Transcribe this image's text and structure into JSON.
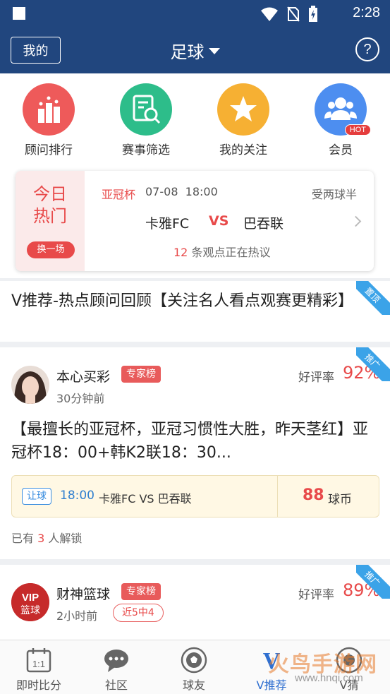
{
  "status_bar": {
    "time": "2:28"
  },
  "header": {
    "my_label": "我的",
    "title": "足球",
    "help_label": "?"
  },
  "quick_actions": [
    {
      "label": "顾问排行",
      "color": "#ee5a5a"
    },
    {
      "label": "赛事筛选",
      "color": "#2dbd8a"
    },
    {
      "label": "我的关注",
      "color": "#f6b033"
    },
    {
      "label": "会员",
      "color": "#4d8ef0",
      "badge": "HOT"
    }
  ],
  "hot_today": {
    "title": "今日热门",
    "swap_label": "换一场",
    "league": "亚冠杯",
    "date": "07-08",
    "time": "18:00",
    "handicap": "受两球半",
    "home_team": "卡雅FC",
    "vs": "VS",
    "away_team": "巴吞联",
    "view_count": "12",
    "view_text": "条观点正在热议"
  },
  "banner": {
    "text": "V推荐-热点顾问回顾【关注名人看点观赛更精彩】",
    "corner": "置顶"
  },
  "posts": [
    {
      "name": "本心买彩",
      "tag": "专家榜",
      "time": "30分钟前",
      "rate_label": "好评率",
      "rate": "92%",
      "corner": "推广",
      "text": "【最擅长的亚冠杯，亚冠习惯性大胜，昨天茎红】亚冠杯18：00+韩K2联18：30...",
      "bet_type": "让球",
      "match_time": "18:00",
      "match_teams": "卡雅FC VS 巴吞联",
      "price": "88",
      "price_unit": "球币",
      "unlock_prefix": "已有",
      "unlock_count": "3",
      "unlock_suffix": "人解锁"
    },
    {
      "name": "财神篮球",
      "tag": "专家榜",
      "time": "2小时前",
      "recent": "近5中4",
      "rate_label": "好评率",
      "rate": "89%",
      "corner": "推广",
      "avatar_text": "VIP\n篮球"
    }
  ],
  "bottom_nav": [
    {
      "label": "即时比分",
      "icon": "calendar-score-icon"
    },
    {
      "label": "社区",
      "icon": "chat-bubble-icon"
    },
    {
      "label": "球友",
      "icon": "soccer-ball-icon"
    },
    {
      "label": "V推荐",
      "icon": "v-recommend-icon",
      "active": true
    },
    {
      "label": "V猜",
      "icon": "v-guess-icon"
    }
  ],
  "watermark": {
    "line1": "火鸟手游网",
    "line2": "www.hnqi.com"
  }
}
